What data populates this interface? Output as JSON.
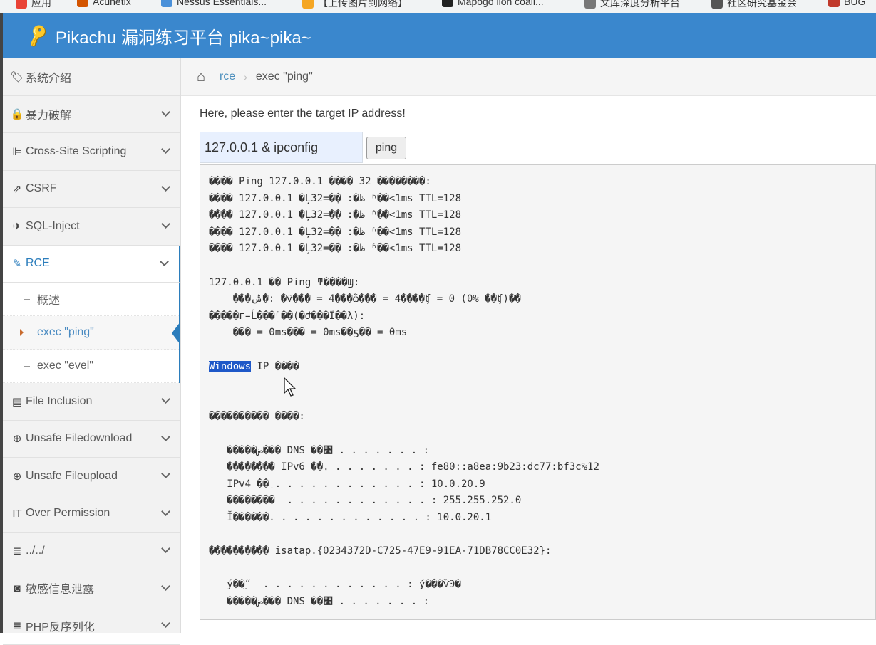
{
  "bookmarks": [
    {
      "label": "应用",
      "color": "#e94235"
    },
    {
      "label": "Acunetix",
      "color": "#d35400"
    },
    {
      "label": "Nessus Essentials...",
      "color": "#4a90d9"
    },
    {
      "label": "【上传图片到网络】",
      "color": "#f5a623"
    },
    {
      "label": "Mapogo lion coali...",
      "color": "#222222"
    },
    {
      "label": "文库深度分析平台",
      "color": "#777777"
    },
    {
      "label": "社区研究基金会",
      "color": "#555555"
    },
    {
      "label": "BUG",
      "color": "#c0392b"
    }
  ],
  "header": {
    "title": "Pikachu 漏洞练习平台 pika~pika~",
    "icon": "key-icon"
  },
  "sidebar": {
    "items": [
      {
        "label": "系统介绍",
        "icon": "tags-icon",
        "glyph": "🏷"
      },
      {
        "label": "暴力破解",
        "icon": "lock-icon",
        "glyph": "🔒"
      },
      {
        "label": "Cross-Site Scripting",
        "icon": "sitemap-icon",
        "glyph": "⊫"
      },
      {
        "label": "CSRF",
        "icon": "share-icon",
        "glyph": "⇗"
      },
      {
        "label": "SQL-Inject",
        "icon": "fighter-jet-icon",
        "glyph": "✈"
      },
      {
        "label": "RCE",
        "icon": "pencil-icon",
        "glyph": "✎"
      },
      {
        "label": "File Inclusion",
        "icon": "file-icon",
        "glyph": "▤"
      },
      {
        "label": "Unsafe Filedownload",
        "icon": "download-icon",
        "glyph": "⊕"
      },
      {
        "label": "Unsafe Fileupload",
        "icon": "upload-icon",
        "glyph": "⊕"
      },
      {
        "label": "Over Permission",
        "icon": "text-height-icon",
        "glyph": "IT"
      },
      {
        "label": "../../",
        "icon": "align-left-icon",
        "glyph": "≣"
      },
      {
        "label": "敏感信息泄露",
        "icon": "camera-icon",
        "glyph": "◙"
      },
      {
        "label": "PHP反序列化",
        "icon": "align-left-icon",
        "glyph": "≣"
      }
    ],
    "rce_sub": [
      {
        "label": "概述"
      },
      {
        "label": "exec \"ping\""
      },
      {
        "label": "exec \"evel\""
      }
    ]
  },
  "breadcrumb": {
    "parent": "rce",
    "current": "exec \"ping\""
  },
  "main": {
    "prompt": "Here, please enter the target IP address!",
    "ip_value": "127.0.0.1 & ipconfig",
    "button_label": "ping",
    "output_before": "���� Ping 127.0.0.1 ���� 32 �ֽ�������:\n���� 127.0.0.1 �Ļظ�: �ֽ�=32 ʱ��<1ms TTL=128\n���� 127.0.0.1 �Ļظ�: �ֽ�=32 ʱ��<1ms TTL=128\n���� 127.0.0.1 �Ļظ�: �ֽ�=32 ʱ��<1ms TTL=128\n���� 127.0.0.1 �Ļظ�: �ֽ�=32 ʱ��<1ms TTL=128\n\n127.0.0.1 �� Ping ͳ����Ϣ:\n    ���ݰ�: �ѷ��� = 4���ѽ��� = 4����ʧ = 0 (0% ��ʧ)��\n�����г̵Ĺ���ʱ��(�Ժ���Ϊ��λ):\n    ��� = 0ms��� = 0ms��ƽ�� = 0ms\n\n",
    "output_selected": "Windows",
    "output_after": " IP ����\n\n\n���������� ����:\n\n   �����ض��� DNS ��׺ . . . . . . . :\n   �������� IPv6 ��ַ. . . . . . . . : fe80::a8ea:9b23:dc77:bf3c%12\n   IPv4 ��ַ . . . . . . . . . . . . : 10.0.20.9\n   ��������  . . . . . . . . . . . . : 255.255.252.0\n   Ĭ������. . . . . . . . . . . . . : 10.0.20.1\n\n���������� isatap.{0234372D-C725-47E9-91EA-71DB78CC0E32}:\n\n   ý��״̬  . . . . . . . . . . . . : ý���ѶϿ�\n   �����ض��� DNS ��׺ . . . . . . . :"
  }
}
